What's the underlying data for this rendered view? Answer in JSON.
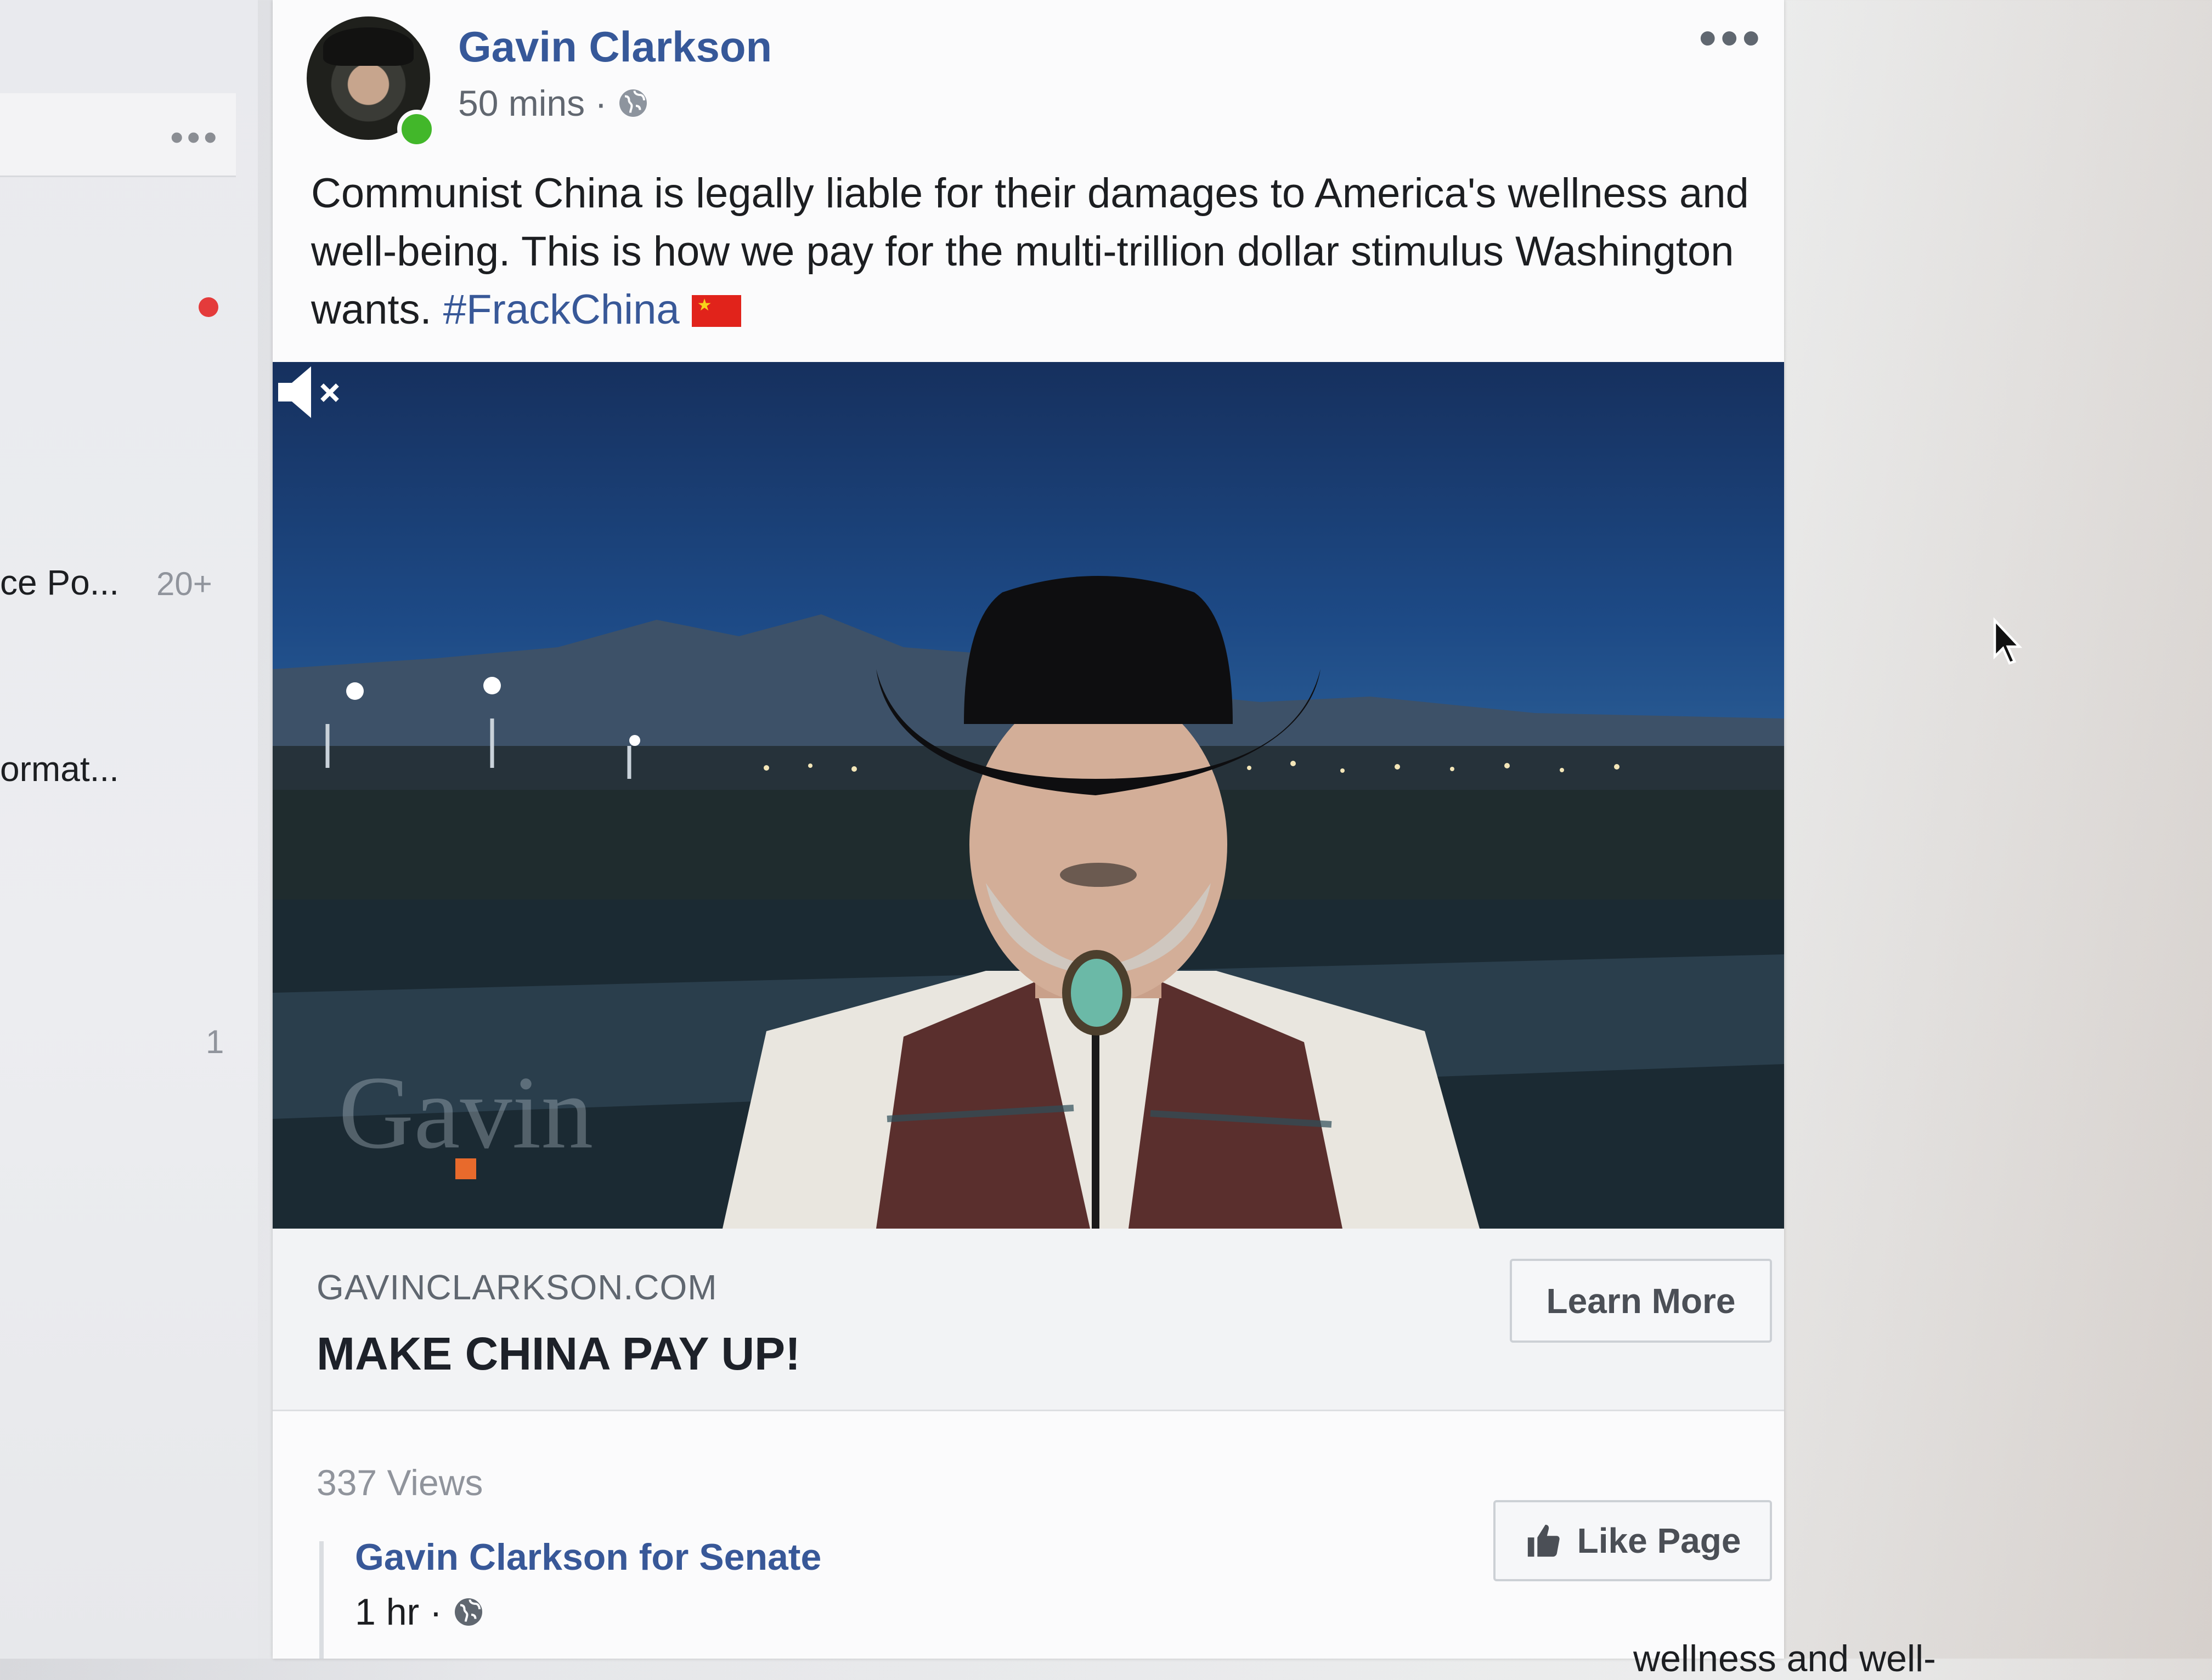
{
  "sidebar": {
    "items": [
      {
        "label": "ce Po...",
        "count": "20+"
      },
      {
        "label": "ormat...",
        "count": ""
      },
      {
        "label": "",
        "count": "1"
      }
    ]
  },
  "post": {
    "author": "Gavin Clarkson",
    "time": "50 mins ·",
    "privacy_icon": "globe-icon",
    "text": "Communist China is legally liable for their damages to America's wellness and well-being. This is how we pay for the multi-trillion dollar stimulus Washington wants. ",
    "hashtag": "#FrackChina",
    "flag_icon": "china-flag-emoji"
  },
  "video": {
    "watermark": "Gavin",
    "muted": true
  },
  "link_preview": {
    "domain": "GAVINCLARKSON.COM",
    "title": "MAKE CHINA PAY UP!",
    "cta_label": "Learn More"
  },
  "stats": {
    "views": "337 Views"
  },
  "shared_post": {
    "page_name": "Gavin Clarkson for Senate",
    "time": "1 hr ·",
    "like_label": "Like Page",
    "peek_text": "wellness and well-"
  },
  "colors": {
    "link_blue": "#365899",
    "online_green": "#42b72a",
    "notification_red": "#e43b3b"
  }
}
